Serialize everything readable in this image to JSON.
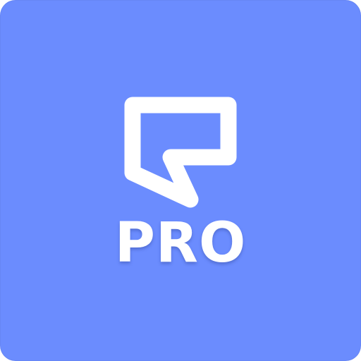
{
  "icon": {
    "background_color": "#6b8cfe",
    "foreground_color": "#ffffff",
    "mark_icon": "speech-bubble-icon",
    "label": "PRO"
  }
}
